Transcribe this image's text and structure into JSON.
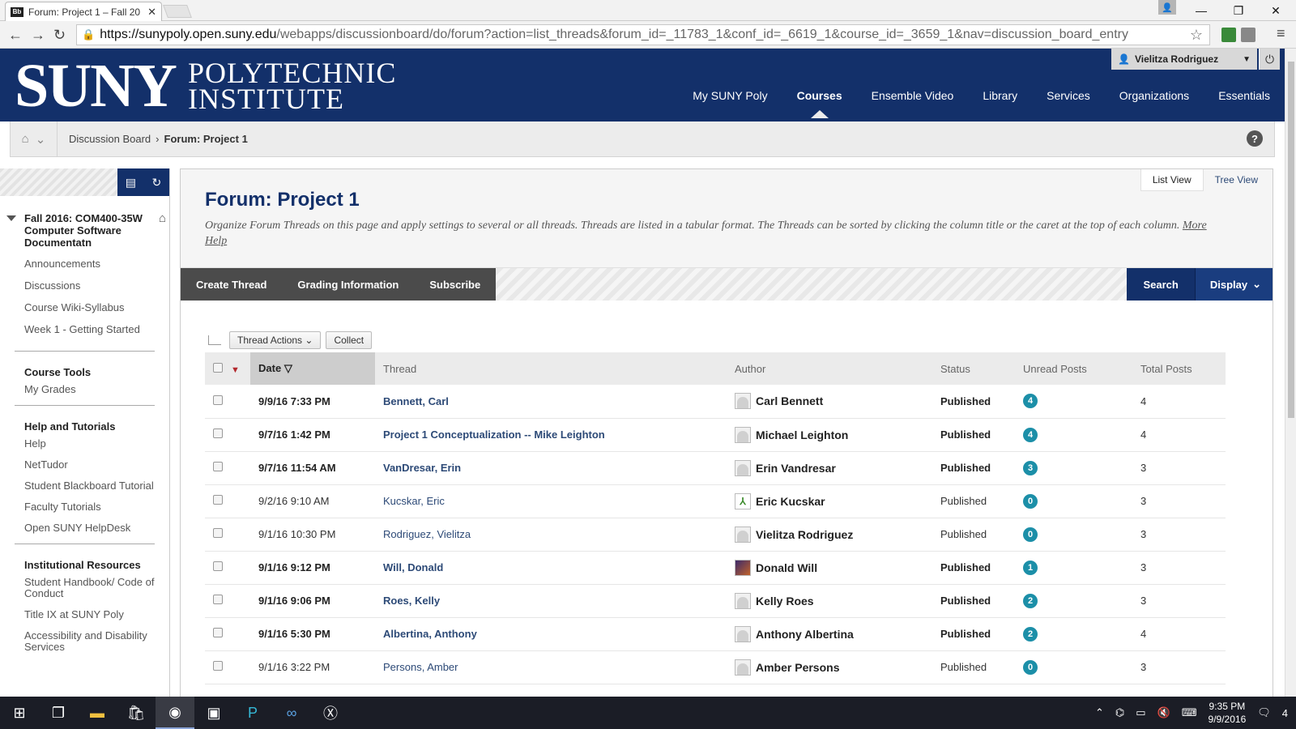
{
  "browser": {
    "tab_title": "Forum: Project 1 – Fall 20",
    "tab_favicon": "Bb",
    "url_host": "https://sunypoly.open.suny.edu",
    "url_path": "/webapps/discussionboard/do/forum?action=list_threads&forum_id=_11783_1&conf_id=_6619_1&course_id=_3659_1&nav=discussion_board_entry"
  },
  "header": {
    "logo_main": "SUNY",
    "logo_line1": "POLYTECHNIC",
    "logo_line2": "INSTITUTE",
    "user_name": "Vielitza Rodriguez",
    "nav": [
      "My SUNY Poly",
      "Courses",
      "Ensemble Video",
      "Library",
      "Services",
      "Organizations",
      "Essentials"
    ],
    "active_nav": "Courses"
  },
  "breadcrumb": {
    "parent": "Discussion Board",
    "current": "Forum: Project 1"
  },
  "sidebar": {
    "course_title": "Fall 2016: COM400-35W Computer Software Documentatn",
    "course_links": [
      "Announcements",
      "Discussions",
      "Course Wiki-Syllabus",
      "Week 1 - Getting Started"
    ],
    "tools_heading": "Course Tools",
    "tools_links": [
      "My Grades"
    ],
    "help_heading": "Help and Tutorials",
    "help_links": [
      "Help",
      "NetTudor",
      "Student Blackboard Tutorial",
      "Faculty Tutorials",
      "Open SUNY HelpDesk"
    ],
    "inst_heading": "Institutional Resources",
    "inst_links": [
      "Student Handbook/ Code of Conduct",
      "Title IX at SUNY Poly",
      "Accessibility and Disability Services"
    ]
  },
  "page": {
    "list_view": "List View",
    "tree_view": "Tree View",
    "title": "Forum: Project 1",
    "description": "Organize Forum Threads on this page and apply settings to several or all threads. Threads are listed in a tabular format. The Threads can be sorted by clicking the column title or the caret at the top of each column.",
    "more_help": "More Help",
    "actions": [
      "Create Thread",
      "Grading Information",
      "Subscribe"
    ],
    "search": "Search",
    "display": "Display",
    "thread_actions": "Thread Actions",
    "collect": "Collect"
  },
  "table": {
    "headers": {
      "date": "Date",
      "thread": "Thread",
      "author": "Author",
      "status": "Status",
      "unread": "Unread Posts",
      "total": "Total Posts"
    },
    "rows": [
      {
        "date": "9/9/16 7:33 PM",
        "thread": "Bennett, Carl",
        "author": "Carl Bennett",
        "status": "Published",
        "unread": "4",
        "total": "4",
        "bold": true
      },
      {
        "date": "9/7/16 1:42 PM",
        "thread": "Project 1 Conceptualization -- Mike Leighton",
        "author": "Michael Leighton",
        "status": "Published",
        "unread": "4",
        "total": "4",
        "bold": true
      },
      {
        "date": "9/7/16 11:54 AM",
        "thread": "VanDresar, Erin",
        "author": "Erin Vandresar",
        "status": "Published",
        "unread": "3",
        "total": "3",
        "bold": true
      },
      {
        "date": "9/2/16 9:10 AM",
        "thread": "Kucskar, Eric",
        "author": "Eric Kucskar",
        "status": "Published",
        "unread": "0",
        "total": "3",
        "bold": false
      },
      {
        "date": "9/1/16 10:30 PM",
        "thread": "Rodriguez, Vielitza",
        "author": "Vielitza Rodriguez",
        "status": "Published",
        "unread": "0",
        "total": "3",
        "bold": false
      },
      {
        "date": "9/1/16 9:12 PM",
        "thread": "Will, Donald",
        "author": "Donald Will",
        "status": "Published",
        "unread": "1",
        "total": "3",
        "bold": true
      },
      {
        "date": "9/1/16 9:06 PM",
        "thread": "Roes, Kelly",
        "author": "Kelly Roes",
        "status": "Published",
        "unread": "2",
        "total": "3",
        "bold": true
      },
      {
        "date": "9/1/16 5:30 PM",
        "thread": "Albertina, Anthony",
        "author": "Anthony Albertina",
        "status": "Published",
        "unread": "2",
        "total": "4",
        "bold": true
      },
      {
        "date": "9/1/16 3:22 PM",
        "thread": "Persons, Amber",
        "author": "Amber Persons",
        "status": "Published",
        "unread": "0",
        "total": "3",
        "bold": false
      }
    ]
  },
  "taskbar": {
    "time": "9:35 PM",
    "date": "9/9/2016",
    "notifications": "4"
  }
}
